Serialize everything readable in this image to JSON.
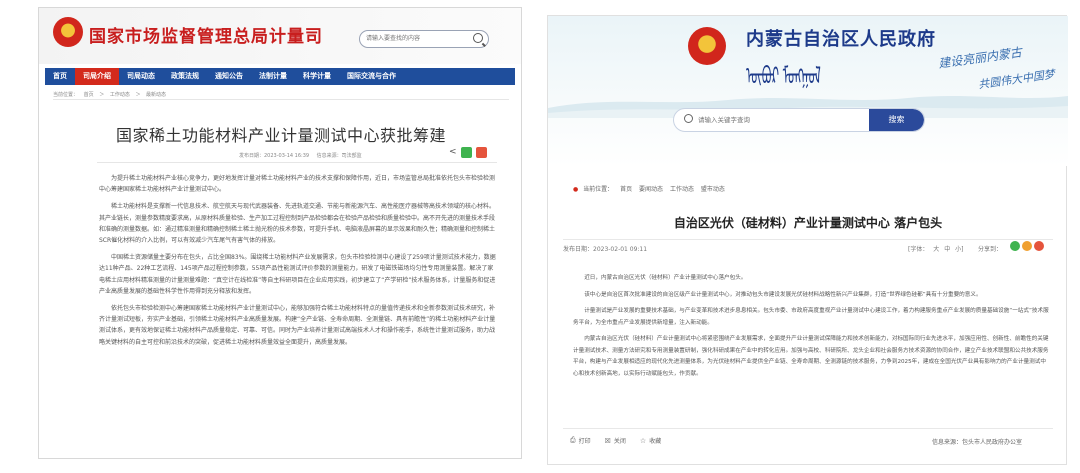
{
  "left": {
    "site_title": "国家市场监督管理总局计量司",
    "search_placeholder": "请输入要查找的内容",
    "nav": [
      "首页",
      "司局介绍",
      "司局动态",
      "政策法规",
      "通知公告",
      "法制计量",
      "科学计量",
      "国际交流与合作"
    ],
    "nav_active_index": 1,
    "breadcrumb": [
      "当前位置：",
      "首页",
      "＞",
      "工作动态",
      "＞",
      "最新动态"
    ],
    "title": "国家稀土功能材料产业计量测试中心获批筹建",
    "meta": {
      "date": "发布日期：2023-03-14 16:39",
      "source": "信息来源：司法部监"
    },
    "share_colors": {
      "wechat": "#3fb34f",
      "weibo": "#e5543c"
    },
    "paragraphs": [
      "为提升稀土功能材料产业核心竞争力，更好地发挥计量对稀土功能材料产业的技术支撑和保障作用，近日，市场监管总局批准依托包头市检验检测中心筹建国家稀土功能材料产业计量测试中心。",
      "稀土功能材料是支撑新一代信息技术、航空航天与现代武器装备、先进轨道交通、节能与新能源汽车、高性能医疗器械等高技术领域的核心材料。其产业链长，测量参数精度要求高，从原材料质量检验、生产加工过程控制到产品检验都会在检验产品检验和质量检验中。高不开先进的测量技术手段和准确的测量数据。如：通过精准测量和精确控制稀土稀土抛光粉的技术参数，可提升手机、电脑液晶屏幕的显示效果和耐久性；精确测量和控制稀土SCR催化材料的介入比例，可以有效减少汽车尾气有害气体的排放。",
      "中国稀土资源储量主要分布在包头，占比全国83%。围绕稀土功能材料产业发展需求，包头市检验检测中心建设了259项计量测试技术能力，数据达11种产品、22种工艺流程、145项产品过程控制参数，55项产品性能测试评价参数的测量能力，研发了电磁铁磁场均匀性专用测量装置。解决了家电稀土应用材料精准测量的计量测量难题：“真空计在线检准”等自主科研项目在企业应用实践，初步建立了“产学研检”技术服务体系，计量服务和促进产业高质量发展的基础性科学性作用得到充分释放和发挥。",
      "依托包头市检验检测中心筹建国家稀土功能材料产业计量测试中心，能够加强符合稀土功能材料特点的量值传递技术和全新参数测试技术研究，补齐计量测试短板，夯实产业基础，引领稀土功能材料产业高质量发展。构建“全产业链、全寿命周期、全测量链、具有前瞻性”的稀土功能材料产业计量测试体系，更有效地保证稀土功能材料产品质量稳定、可靠、可信。同时为产业培养计量测试高端技术人才和操作能手，系统性计量测试服务，助力战略关键材料的自主可控和前沿技术的突破，促进稀土功能材料质量效益全面提升，高质量发展。"
    ]
  },
  "right": {
    "gov_title": "内蒙古自治区人民政府",
    "mongol_text": "ᠥᠪᠦᠷ ᠮᠣᠩᠭᠣᠯ",
    "slogan_1": "建设亮丽内蒙古",
    "slogan_2": "共圆伟大中国梦",
    "search_placeholder": "请输入关键字查询",
    "search_button": "搜索",
    "breadcrumb": [
      "当前位置：",
      "首页",
      "要闻动态",
      "工作动态",
      "盟市动态"
    ],
    "title": "自治区光伏（硅材料）产业计量测试中心 落户包头",
    "meta_date": "发布日期：2023-02-01 09:11",
    "font_size": [
      "[字体：",
      "大",
      "中",
      "小]"
    ],
    "share_label": "分享到：",
    "share_colors": {
      "wechat": "#3fb34f",
      "weibo": "#f0a030",
      "other": "#e5543c"
    },
    "paragraphs": [
      "近日，内蒙古自治区光伏（硅材料）产业计量测试中心落户包头。",
      "该中心是自治区首次批准建设的自治区级产业计量测试中心，对推动包头市建设发展光伏硅材料战略性新兴产业集群，打造“世界绿色硅都”具有十分重要的意义。",
      "计量测试是产业发展的重要技术基础，与产业变革和技术进步息息相关。包头市委、市政府高度重视产业计量测试中心建设工作，着力构建服务重点产业发展的质量基础设施“一站式”技术服务平台，为全市重点产业发展提供新增量，注入新动能。",
      "内蒙古自治区光伏（硅材料）产业计量测试中心将紧密围绕产业发展需求，全面提升产业计量测试保障能力和技术创新能力，对标国际同行业先进水平，加强应用性、创新性、前瞻性的关键计量测试技术、测量方法研究和专用测量装置研制，强化科研成果在产业中的转化应用。加强与高校、科研院所、龙头企业和社会服务方技术资源的协同合作，建立产业技术联盟和公共技术服务平台，构建与产业发展相适应的现代化先进测量体系，为光伏硅材料产业提供全产业链、全寿命周期、全测源链的技术服务，力争到2025年，建成在全国光伏产业具有影响力的产业计量测试中心和技术创新高地，以实际行动赋能包头，作贡献。"
    ],
    "actions": [
      "打印",
      "关闭",
      "收藏"
    ],
    "source": "信息来源：包头市人民政府办公室"
  }
}
